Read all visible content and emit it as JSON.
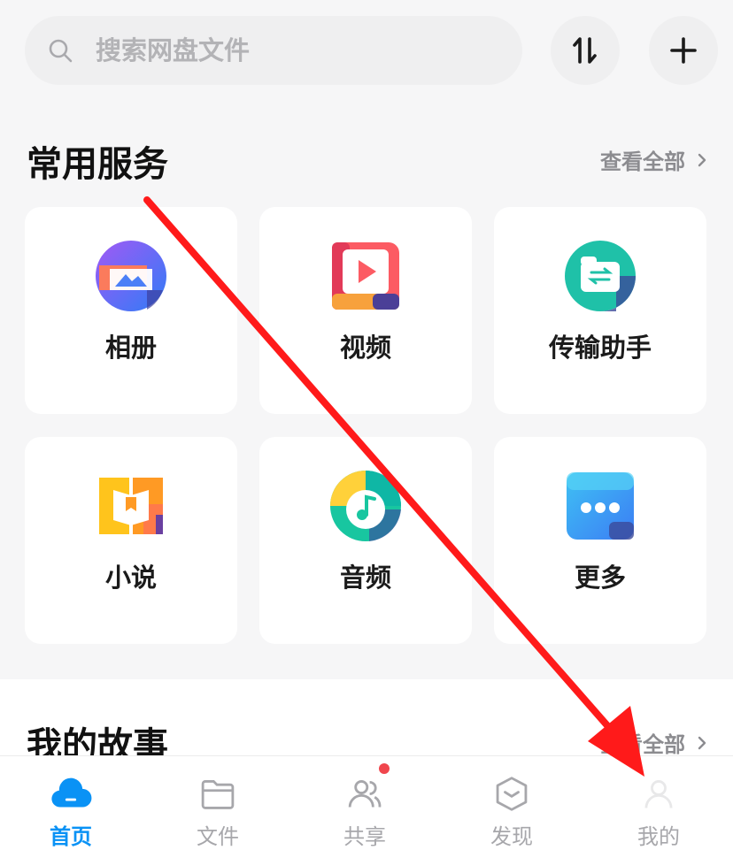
{
  "search": {
    "placeholder": "搜索网盘文件"
  },
  "sections": {
    "common_services": {
      "title": "常用服务",
      "see_all": "查看全部"
    },
    "my_story": {
      "title": "我的故事",
      "see_all": "查看全部"
    }
  },
  "services": [
    {
      "label": "相册",
      "icon": "photo-album-icon"
    },
    {
      "label": "视频",
      "icon": "video-play-icon"
    },
    {
      "label": "传输助手",
      "icon": "transfer-assistant-icon"
    },
    {
      "label": "小说",
      "icon": "novel-book-icon"
    },
    {
      "label": "音频",
      "icon": "audio-music-icon"
    },
    {
      "label": "更多",
      "icon": "more-dots-icon"
    }
  ],
  "nav": [
    {
      "label": "首页",
      "icon": "home-cloud-icon",
      "active": true
    },
    {
      "label": "文件",
      "icon": "folder-icon"
    },
    {
      "label": "共享",
      "icon": "share-people-icon",
      "badge": true
    },
    {
      "label": "发现",
      "icon": "discover-box-icon"
    },
    {
      "label": "我的",
      "icon": "profile-icon"
    }
  ],
  "colors": {
    "accent_blue": "#0a92f5",
    "badge_red": "#f0464d",
    "annotation_arrow": "#ff1a1a"
  }
}
